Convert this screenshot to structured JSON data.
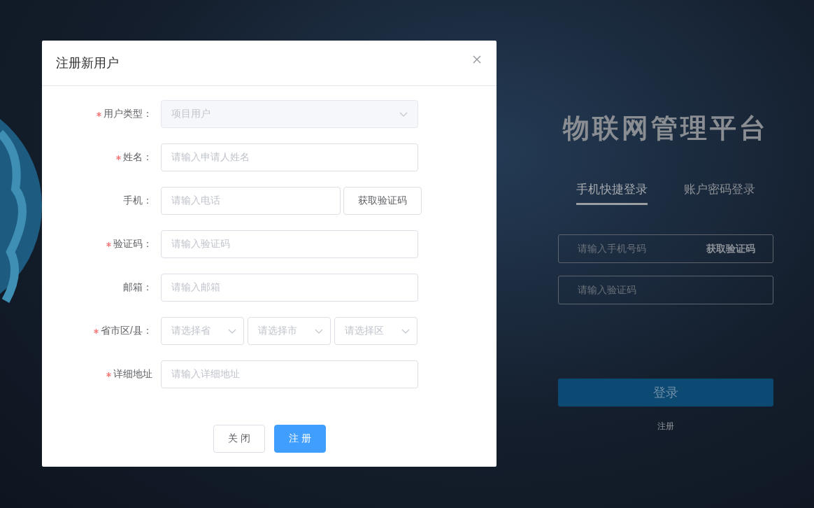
{
  "modal": {
    "title": "注册新用户",
    "fields": [
      {
        "kind": "select",
        "label": "用户类型：",
        "required": true,
        "disabled": true,
        "value": "项目用户"
      },
      {
        "kind": "input",
        "label": "姓名：",
        "required": true,
        "placeholder": "请输入申请人姓名"
      },
      {
        "kind": "input_button",
        "label": "手机：",
        "required": false,
        "placeholder": "请输入电话",
        "button": "获取验证码"
      },
      {
        "kind": "input",
        "label": "验证码：",
        "required": true,
        "placeholder": "请输入验证码"
      },
      {
        "kind": "input",
        "label": "邮箱：",
        "required": false,
        "placeholder": "请输入邮箱"
      },
      {
        "kind": "cascade",
        "label": "省市区/县：",
        "required": true,
        "selects": [
          {
            "placeholder": "请选择省"
          },
          {
            "placeholder": "请选择市"
          },
          {
            "placeholder": "请选择区"
          }
        ]
      },
      {
        "kind": "input",
        "label": "详细地址",
        "required": true,
        "placeholder": "请输入详细地址"
      }
    ],
    "buttons": [
      {
        "label": "关 闭",
        "kind": "default"
      },
      {
        "label": "注 册",
        "kind": "primary"
      }
    ]
  },
  "login": {
    "title": "物联网管理平台",
    "tabs": [
      {
        "label": "手机快捷登录",
        "selected": true
      },
      {
        "label": "账户密码登录",
        "selected": false
      }
    ],
    "phone": {
      "placeholder": "请输入手机号码",
      "link": "获取验证码"
    },
    "code": {
      "placeholder": "请输入验证码"
    },
    "submit": "登录",
    "register": "注册"
  }
}
